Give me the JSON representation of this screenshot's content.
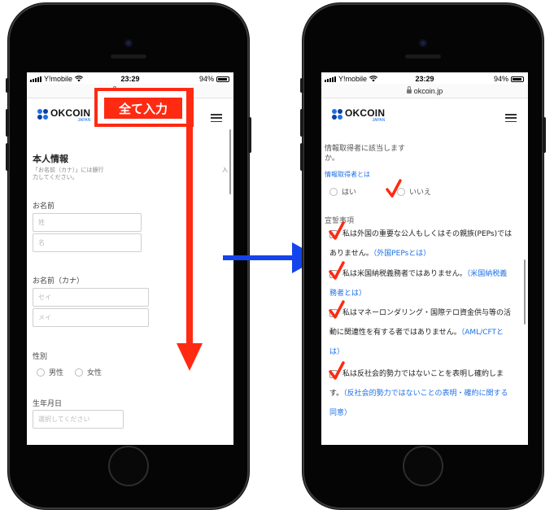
{
  "status_bar": {
    "carrier": "Y!mobile",
    "time": "23:29",
    "battery": "94%",
    "battery_level": 0.94
  },
  "url_bar": {
    "domain": "okcoin.jp"
  },
  "logo": {
    "name": "OKCOIN",
    "sub": "JAPAN"
  },
  "left_screen": {
    "title": "本人情報",
    "note_line1": "「お名前（カナ）」には銀行",
    "note_trail": "入",
    "note_line2": "力してください。",
    "name_label": "お名前",
    "last_name_placeholder": "姓",
    "first_name_placeholder": "名",
    "kana_label": "お名前（カナ）",
    "kana_last_placeholder": "セイ",
    "kana_first_placeholder": "メイ",
    "gender_label": "性別",
    "gender_options": [
      "男性",
      "女性"
    ],
    "dob_label": "生年月日",
    "dob_placeholder": "選択してください"
  },
  "annotation": {
    "label": "全て入力",
    "color": "#ff2a12"
  },
  "right_screen": {
    "pep_question_line1": "情報取得者に該当します",
    "pep_question_line2": "か。",
    "info_link": "情報取得者とは",
    "yes_option": "はい",
    "no_option": "いいえ",
    "declaration_title": "宣誓事項",
    "items": [
      {
        "line1": "私は外国の重要な公人もしくはその親族(PEPs)では",
        "line2": "ありません。",
        "link": "（外国PEPsとは）"
      },
      {
        "line1": "私は米国納税義務者ではありません。",
        "link1": "（米国納税義",
        "link2": "務者とは）"
      },
      {
        "line1": "私はマネーロンダリング・国際テロ資金供与等の活",
        "line2": "動に関連性を有する者ではありません。",
        "link1": "（AML/CFTと",
        "link2": "は）"
      },
      {
        "line1": "私は反社会的勢力ではないことを表明し確約しま",
        "line2": "す。",
        "link1": "（反社会的勢力ではないことの表明・確約に関する",
        "link2": "同意）"
      }
    ]
  },
  "colors": {
    "accent_blue": "#1e70e8",
    "arrow_blue": "#1444ee",
    "annotation_red": "#ff2a12"
  }
}
